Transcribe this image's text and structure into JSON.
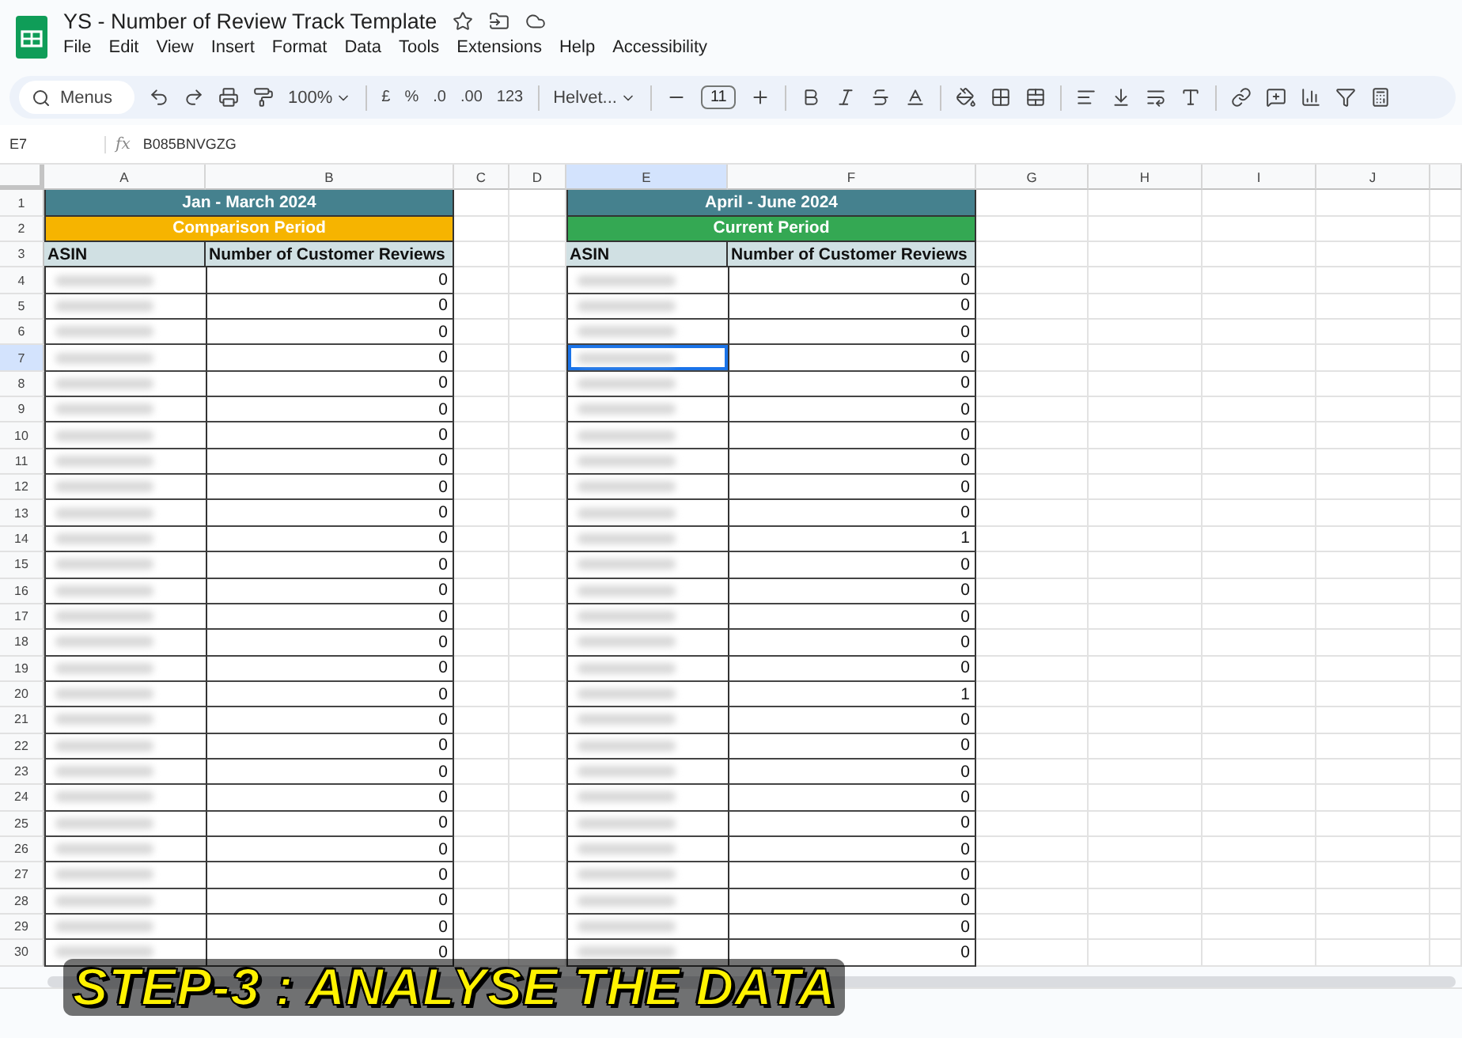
{
  "app": {
    "title": "YS - Number of Review Track Template",
    "menu": [
      "File",
      "Edit",
      "View",
      "Insert",
      "Format",
      "Data",
      "Tools",
      "Extensions",
      "Help",
      "Accessibility"
    ]
  },
  "toolbar": {
    "search_placeholder": "Menus",
    "zoom": "100%",
    "currency": "£",
    "percent": "%",
    "decrease_decimal": ".0",
    "increase_decimal": ".00",
    "number_format": "123",
    "font": "Helvet...",
    "font_size": "11"
  },
  "formula_bar": {
    "cell": "E7",
    "function_label": "fx",
    "value": "B085BNVGZG"
  },
  "sheet": {
    "columns": [
      {
        "label": "A",
        "selected": false
      },
      {
        "label": "B",
        "selected": false
      },
      {
        "label": "C",
        "selected": false
      },
      {
        "label": "D",
        "selected": false
      },
      {
        "label": "E",
        "selected": true
      },
      {
        "label": "F",
        "selected": false
      },
      {
        "label": "G",
        "selected": false
      },
      {
        "label": "H",
        "selected": false
      },
      {
        "label": "I",
        "selected": false
      },
      {
        "label": "J",
        "selected": false
      }
    ],
    "row_numbers": [
      {
        "label": "1",
        "selected": false
      },
      {
        "label": "2",
        "selected": false
      },
      {
        "label": "3",
        "selected": false
      },
      {
        "label": "4",
        "selected": false
      },
      {
        "label": "5",
        "selected": false
      },
      {
        "label": "6",
        "selected": false
      },
      {
        "label": "7",
        "selected": true
      },
      {
        "label": "8",
        "selected": false
      },
      {
        "label": "9",
        "selected": false
      },
      {
        "label": "10",
        "selected": false
      },
      {
        "label": "11",
        "selected": false
      },
      {
        "label": "12",
        "selected": false
      },
      {
        "label": "13",
        "selected": false
      },
      {
        "label": "14",
        "selected": false
      },
      {
        "label": "15",
        "selected": false
      },
      {
        "label": "16",
        "selected": false
      },
      {
        "label": "17",
        "selected": false
      },
      {
        "label": "18",
        "selected": false
      },
      {
        "label": "19",
        "selected": false
      },
      {
        "label": "20",
        "selected": false
      },
      {
        "label": "21",
        "selected": false
      },
      {
        "label": "22",
        "selected": false
      },
      {
        "label": "23",
        "selected": false
      },
      {
        "label": "24",
        "selected": false
      },
      {
        "label": "25",
        "selected": false
      },
      {
        "label": "26",
        "selected": false
      },
      {
        "label": "27",
        "selected": false
      },
      {
        "label": "28",
        "selected": false
      },
      {
        "label": "29",
        "selected": false
      },
      {
        "label": "30",
        "selected": false
      }
    ],
    "blocks": [
      {
        "title": "Jan - March 2024",
        "period": "Comparison Period",
        "kind": "comparison",
        "headers": [
          "ASIN",
          "Number of Customer Reviews"
        ],
        "rows": [
          {
            "reviews": "0",
            "selected": false
          },
          {
            "reviews": "0",
            "selected": false
          },
          {
            "reviews": "0",
            "selected": false
          },
          {
            "reviews": "0",
            "selected": false
          },
          {
            "reviews": "0",
            "selected": false
          },
          {
            "reviews": "0",
            "selected": false
          },
          {
            "reviews": "0",
            "selected": false
          },
          {
            "reviews": "0",
            "selected": false
          },
          {
            "reviews": "0",
            "selected": false
          },
          {
            "reviews": "0",
            "selected": false
          },
          {
            "reviews": "0",
            "selected": false
          },
          {
            "reviews": "0",
            "selected": false
          },
          {
            "reviews": "0",
            "selected": false
          },
          {
            "reviews": "0",
            "selected": false
          },
          {
            "reviews": "0",
            "selected": false
          },
          {
            "reviews": "0",
            "selected": false
          },
          {
            "reviews": "0",
            "selected": false
          },
          {
            "reviews": "0",
            "selected": false
          },
          {
            "reviews": "0",
            "selected": false
          },
          {
            "reviews": "0",
            "selected": false
          },
          {
            "reviews": "0",
            "selected": false
          },
          {
            "reviews": "0",
            "selected": false
          },
          {
            "reviews": "0",
            "selected": false
          },
          {
            "reviews": "0",
            "selected": false
          },
          {
            "reviews": "0",
            "selected": false
          },
          {
            "reviews": "0",
            "selected": false
          },
          {
            "reviews": "0",
            "selected": false
          }
        ]
      },
      {
        "title": "April - June 2024",
        "period": "Current Period",
        "kind": "current",
        "headers": [
          "ASIN",
          "Number of Customer Reviews"
        ],
        "rows": [
          {
            "reviews": "0",
            "selected": false
          },
          {
            "reviews": "0",
            "selected": false
          },
          {
            "reviews": "0",
            "selected": false
          },
          {
            "reviews": "0",
            "selected": true
          },
          {
            "reviews": "0",
            "selected": false
          },
          {
            "reviews": "0",
            "selected": false
          },
          {
            "reviews": "0",
            "selected": false
          },
          {
            "reviews": "0",
            "selected": false
          },
          {
            "reviews": "0",
            "selected": false
          },
          {
            "reviews": "0",
            "selected": false
          },
          {
            "reviews": "1",
            "selected": false
          },
          {
            "reviews": "0",
            "selected": false
          },
          {
            "reviews": "0",
            "selected": false
          },
          {
            "reviews": "0",
            "selected": false
          },
          {
            "reviews": "0",
            "selected": false
          },
          {
            "reviews": "0",
            "selected": false
          },
          {
            "reviews": "1",
            "selected": false
          },
          {
            "reviews": "0",
            "selected": false
          },
          {
            "reviews": "0",
            "selected": false
          },
          {
            "reviews": "0",
            "selected": false
          },
          {
            "reviews": "0",
            "selected": false
          },
          {
            "reviews": "0",
            "selected": false
          },
          {
            "reviews": "0",
            "selected": false
          },
          {
            "reviews": "0",
            "selected": false
          },
          {
            "reviews": "0",
            "selected": false
          },
          {
            "reviews": "0",
            "selected": false
          },
          {
            "reviews": "0",
            "selected": false
          }
        ]
      }
    ]
  },
  "caption": "STEP-3 : ANALYSE THE DATA"
}
